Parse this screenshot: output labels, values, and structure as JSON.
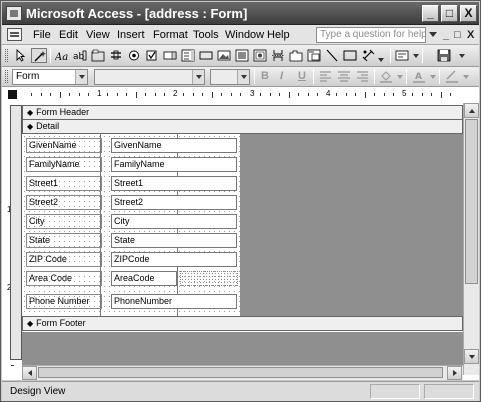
{
  "window": {
    "title": "Microsoft Access - [address : Form]",
    "buttons": [
      "_",
      "□",
      "X"
    ]
  },
  "menubar": {
    "items": [
      "File",
      "Edit",
      "View",
      "Insert",
      "Format",
      "Tools",
      "Window",
      "Help"
    ],
    "ask_placeholder": "Type a question for help",
    "mdi_buttons": [
      "_",
      "□",
      "X"
    ]
  },
  "toolbar_formatting": {
    "object_combo": "Form",
    "font_combo": "",
    "size_combo": "",
    "bold": "B",
    "italic": "I",
    "underline": "U"
  },
  "design": {
    "ruler_numbers": [
      "1",
      "2",
      "3",
      "4",
      "5"
    ],
    "vruler_numbers": [
      "1",
      "2"
    ],
    "sections": {
      "header": "Form Header",
      "detail": "Detail",
      "footer": "Form Footer"
    },
    "fields": [
      {
        "label": "GivenName",
        "control": "GivenName"
      },
      {
        "label": "FamilyName",
        "control": "FamilyName"
      },
      {
        "label": "Street1",
        "control": "Street1"
      },
      {
        "label": "Street2",
        "control": "Street2"
      },
      {
        "label": "City",
        "control": "City"
      },
      {
        "label": "State",
        "control": "State"
      },
      {
        "label": "ZIP Code",
        "control": "ZIPCode"
      },
      {
        "label": "Area Code",
        "control": "AreaCode"
      },
      {
        "label": "Phone Number",
        "control": "PhoneNumber"
      }
    ]
  },
  "statusbar": {
    "text": "Design View"
  }
}
